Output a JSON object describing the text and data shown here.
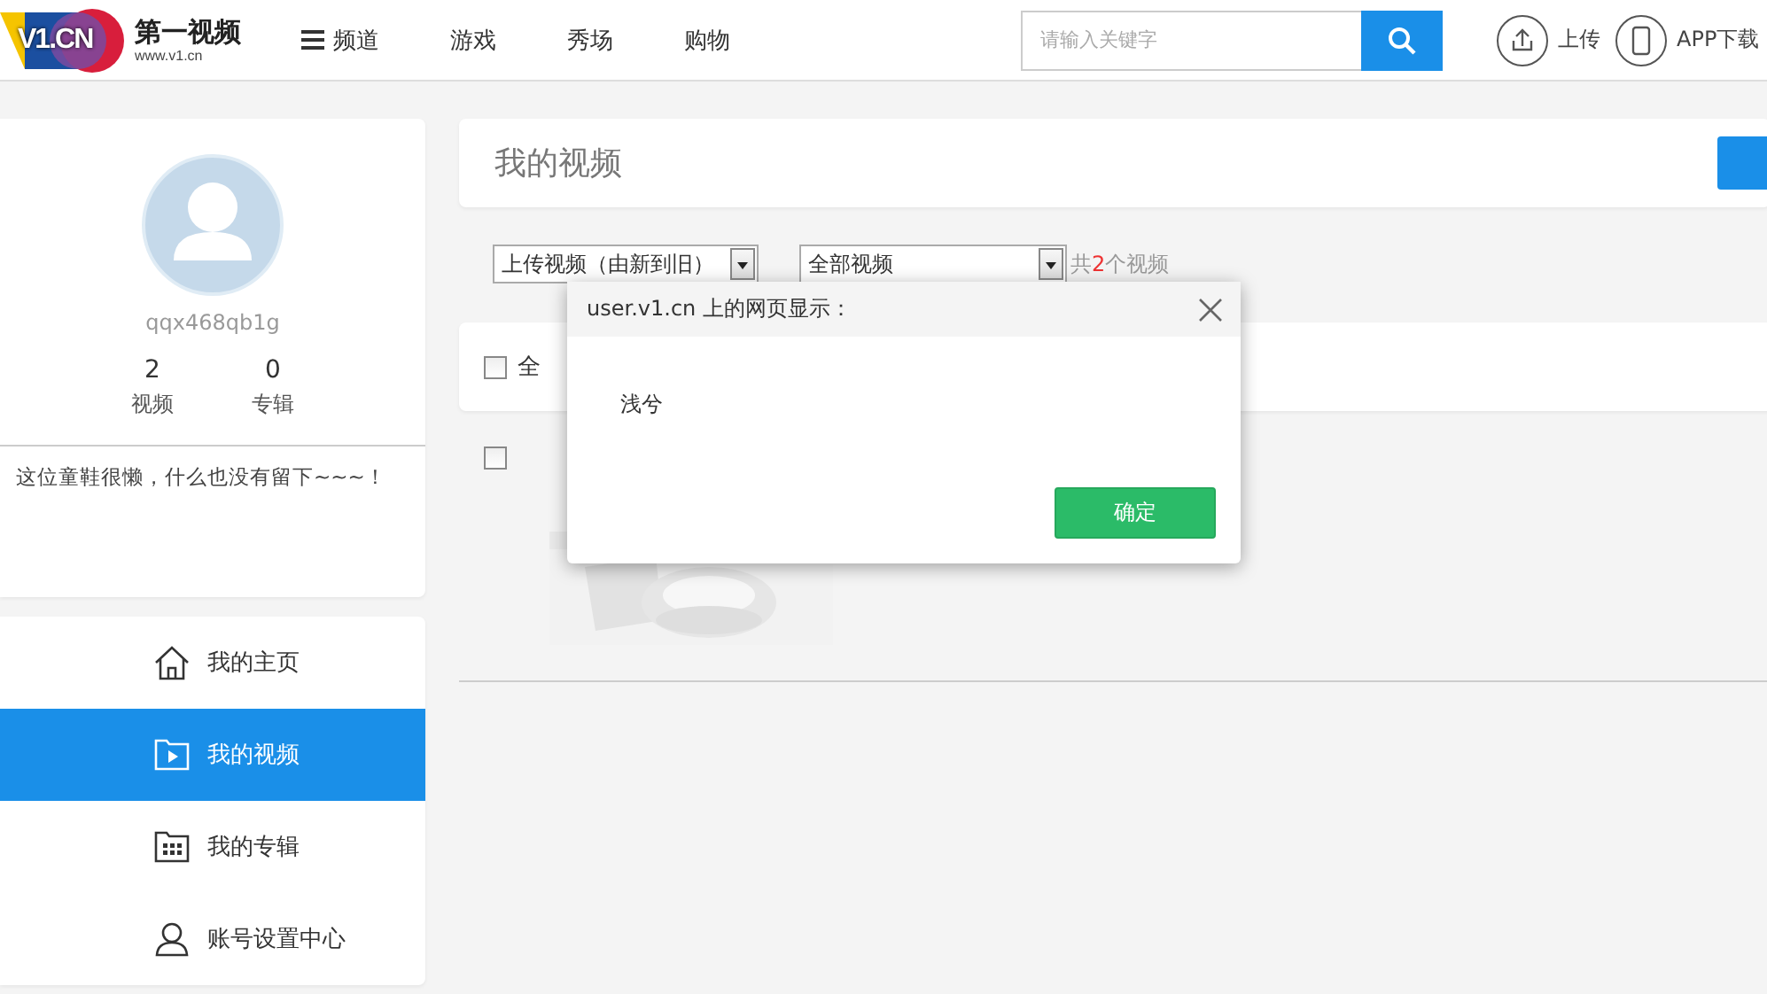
{
  "header": {
    "logo": {
      "mark": "V1.CN",
      "name": "第一视频",
      "url": "www.v1.cn"
    },
    "nav": [
      {
        "label": "频道",
        "kind": "menu"
      },
      {
        "label": "游戏",
        "kind": "link"
      },
      {
        "label": "秀场",
        "kind": "link"
      },
      {
        "label": "购物",
        "kind": "link"
      }
    ],
    "search": {
      "placeholder": "请输入关键字"
    },
    "actions": [
      {
        "label": "上传",
        "kind": "upload"
      },
      {
        "label": "APP下载",
        "kind": "phone"
      }
    ]
  },
  "profile": {
    "username": "qqx468qb1g",
    "stats": [
      {
        "value": "2",
        "label": "视频"
      },
      {
        "value": "0",
        "label": "专辑"
      }
    ],
    "bio": "这位童鞋很懒，什么也没有留下~~~！"
  },
  "sidebar": {
    "items": [
      {
        "label": "我的主页",
        "kind": "home",
        "selected": false
      },
      {
        "label": "我的视频",
        "kind": "video",
        "selected": true
      },
      {
        "label": "我的专辑",
        "kind": "album",
        "selected": false
      },
      {
        "label": "账号设置中心",
        "kind": "user",
        "selected": false
      }
    ]
  },
  "main": {
    "title": "我的视频",
    "sort": {
      "value": "上传视频（由新到旧）"
    },
    "filter": {
      "value": "全部视频"
    },
    "count": {
      "prefix": "共",
      "number": "2",
      "suffix": "个视频"
    },
    "select_all": {
      "label": "全",
      "checked": false
    },
    "videos": [
      {
        "checked": false
      }
    ]
  },
  "dialog": {
    "title": "user.v1.cn 上的网页显示：",
    "message": "浅兮",
    "ok": "确定"
  }
}
